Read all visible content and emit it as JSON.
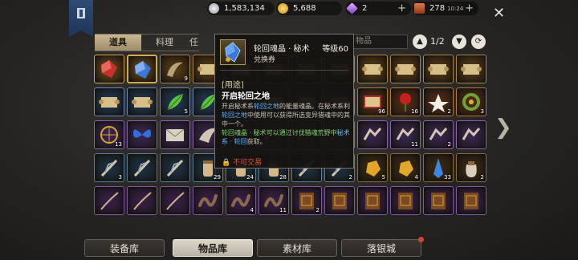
{
  "currency": {
    "silver": "1,583,134",
    "gold": "5,688",
    "gem": "2",
    "energy": "278",
    "energy_time": "10:24"
  },
  "inventory_tabs": [
    {
      "label": "道具",
      "active": true
    },
    {
      "label": "料理",
      "active": false
    },
    {
      "label": "任",
      "active": false
    }
  ],
  "search": {
    "placeholder": "物品"
  },
  "pager": {
    "text": "1/2"
  },
  "tooltip": {
    "name": "轮回魂晶 · 秘术",
    "level": "等级60",
    "type": "兑换券",
    "usage_label": "[用途]",
    "heading": "开启轮回之地",
    "desc_1a": "开启秘术系",
    "desc_1b": "轮回之地",
    "desc_1c": "的能量魂晶。在秘术系利",
    "desc_1d": "轮回之地",
    "desc_1e": "中使用可以获得所选变异猎魂中的其中一个。",
    "desc_2a": "轮回魂晶 · 秘术",
    "desc_2b": "可以通过讨伐猎魂荒野中",
    "desc_2c": "秘术系 · 轮回",
    "desc_2d": "获取。",
    "trade": "不可交易"
  },
  "grid": {
    "counts": {
      "r0c2": "9",
      "r1c2": "5",
      "r2c0": "13",
      "r2c4": "3",
      "r1c8": "96",
      "r1c9": "16",
      "r1c10": "2",
      "r1c11": "3",
      "r2c9": "11",
      "r2c10": "2",
      "r3c3": "29",
      "r3c4": "24",
      "r3c5": "28",
      "r3c7": "2",
      "r3c8": "5",
      "r3c9": "4",
      "r3c10": "33",
      "r3c11": "2",
      "r4c4": "4",
      "r4c5": "11",
      "r4c6": "2",
      "r3c0": "3"
    }
  },
  "bottom_tabs": [
    {
      "label": "装备库",
      "active": false
    },
    {
      "label": "物品库",
      "active": true
    },
    {
      "label": "素材库",
      "active": false
    },
    {
      "label": "落银城",
      "active": false
    }
  ],
  "colors": {
    "gold_rim": "#c9b78f",
    "blue_text": "#5fb5ff",
    "green_text": "#7cd46a",
    "red_text": "#e0533c"
  }
}
